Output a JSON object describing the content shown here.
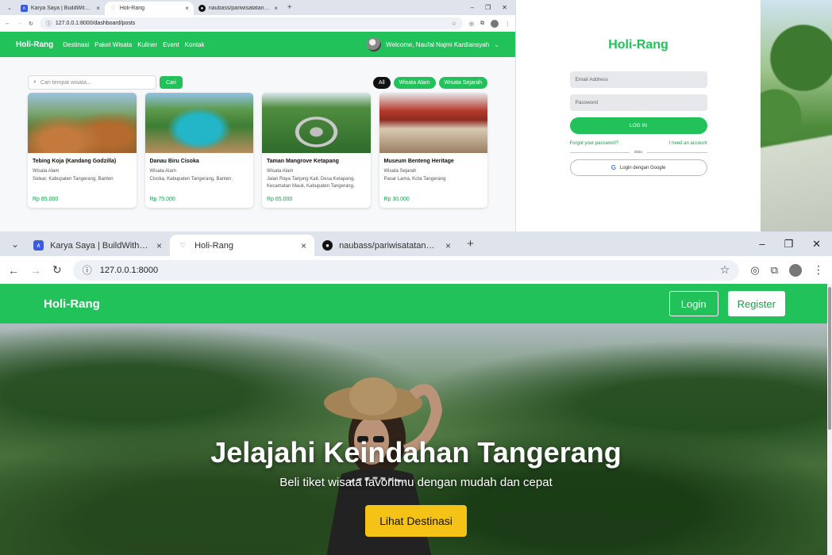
{
  "top_left_window": {
    "tabs": [
      {
        "label": "Karya Saya | BuildWithAngga",
        "favicon": "buildwithangga-icon",
        "active": false
      },
      {
        "label": "Holi-Rang",
        "favicon": "holi-rang-icon",
        "active": true
      },
      {
        "label": "naubass/pariwisatatangerang",
        "favicon": "github-icon",
        "active": false
      }
    ],
    "url": "127.0.0.1:8000/dashboard/posts",
    "navbar": {
      "brand": "Holi-Rang",
      "links": [
        "Destinasi",
        "Paket Wisata",
        "Kuliner",
        "Event",
        "Kontak"
      ],
      "user_greeting": "Welcome, Naufal Najmi Kardiansyah"
    },
    "search": {
      "placeholder": "Cari tempat wisata...",
      "button": "Cari"
    },
    "filters": [
      "All",
      "Wisata Alam",
      "Wisata Sejarah"
    ],
    "cards": [
      {
        "title": "Tebing Koja (Kandang Godzilla)",
        "category": "Wisata Alam",
        "location": "Solear, Kabupaten Tangerang, Banten",
        "price": "Rp 85.000"
      },
      {
        "title": "Danau Biru Cisoka",
        "category": "Wisata Alam",
        "location": "Cisoka, Kabupaten Tangerang, Banten.",
        "price": "Rp 75.000"
      },
      {
        "title": "Taman Mangrove Ketapang",
        "category": "Wisata Alam",
        "location": "Jalan Raya Tanjung Kait, Desa Ketapang, Kecamatan Mauk, Kabupaten Tangerang.",
        "price": "Rp 65.000"
      },
      {
        "title": "Museum Benteng Heritage",
        "category": "Wisata Sejarah",
        "location": "Pasar Lama, Kota Tangerang",
        "price": "Rp 30.000"
      }
    ]
  },
  "login_window": {
    "brand": "Holi-Rang",
    "email_placeholder": "Email Address",
    "password_placeholder": "Password",
    "login_button": "LOG IN",
    "forgot_password": "Forgot your password?",
    "need_account": "I need an account",
    "divider": "atau",
    "google_button": "Login dengan Google"
  },
  "bottom_window": {
    "tabs": [
      {
        "label": "Karya Saya | BuildWithAngga",
        "favicon": "buildwithangga-icon",
        "active": false
      },
      {
        "label": "Holi-Rang",
        "favicon": "holi-rang-icon",
        "active": true
      },
      {
        "label": "naubass/pariwisatatangerang",
        "favicon": "github-icon",
        "active": false
      }
    ],
    "url": "127.0.0.1:8000",
    "navbar": {
      "brand": "Holi-Rang",
      "login": "Login",
      "register": "Register"
    },
    "hero": {
      "title": "Jelajahi Keindahan Tangerang",
      "subtitle": "Beli tiket wisata favoritmu dengan mudah dan cepat",
      "cta": "Lihat Destinasi"
    }
  },
  "colors": {
    "brand_green": "#22c25a",
    "price_green": "#16a34a",
    "cta_yellow": "#f4c316"
  }
}
